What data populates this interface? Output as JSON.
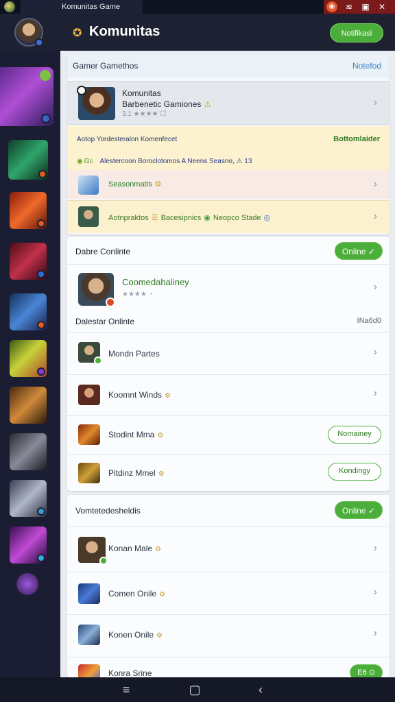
{
  "window": {
    "tab_title": "Komunitas Game",
    "sys_icons": [
      "notification-icon",
      "wifi-icon",
      "maximize-icon",
      "close-icon"
    ],
    "sys_glyphs": [
      "◉",
      "≋",
      "▣",
      "✕"
    ]
  },
  "header": {
    "brand": "Komunitas",
    "logo_glyph": "✪",
    "cta_label": "Notifikasi"
  },
  "sidebar": {
    "games": [
      "game-1",
      "game-2",
      "game-3",
      "game-4",
      "game-5",
      "game-6",
      "game-7",
      "game-8",
      "game-9",
      "game-10",
      "game-11"
    ]
  },
  "card_a": {
    "title": "Gamer Gamethos",
    "action": "Notefod",
    "featured": {
      "line1": "Komunitas",
      "line2": "Barbenetic Gamiones",
      "warn": "⚠",
      "line3": "3.1 ★★★★ ☐"
    },
    "notice": {
      "title": "Aotop Yordesteralon Komenfecet",
      "badge": "Bottomlaider",
      "sub_c1": "◉",
      "sub_c2": "Gc",
      "sub_text": "Alestercoon Boroclotomos A Neens Seasno, ⚠ 13"
    },
    "row3": {
      "label": "Seasonmatis",
      "em": "⚙"
    },
    "row4": {
      "a": "Aotnpraktos",
      "sep": "☰",
      "b": "Bacesipnics",
      "g": "◉",
      "c": "Neopco Stade",
      "d": "◎"
    }
  },
  "card_b": {
    "title": "Dabre Conlinte",
    "status_pill": "Online ✓",
    "featured": {
      "line1": "Coomedahaliney",
      "line2": "★★★★ ◔"
    },
    "section_label": "Dalestar Onlinte",
    "section_right": "INa6d0",
    "rows": [
      {
        "label": "Mondn Partes",
        "em": "",
        "button": ""
      },
      {
        "label": "Koomnt Winds",
        "em": "⚙",
        "button": ""
      },
      {
        "label": "Stodint Mma",
        "em": "⚙",
        "button": "Nomainey"
      },
      {
        "label": "Pitdinz Mmel",
        "em": "⚙",
        "button": "Kondingy"
      }
    ]
  },
  "card_c": {
    "title": "Vomtetedesheldis",
    "status_pill": "Online ✓",
    "rows": [
      {
        "label": "Konan Male",
        "em": "⚙"
      },
      {
        "label": "Comen Onile",
        "em": "⚙"
      },
      {
        "label": "Konen Onile",
        "em": "⚙"
      },
      {
        "label": "Konra Srine",
        "em": ""
      }
    ],
    "last_pill": "E6 ⊙"
  },
  "nav": {
    "menu": "≡",
    "home": "▢",
    "back": "‹"
  },
  "colors": {
    "accent_green": "#4cae3a",
    "sidebar_bg": "#1b1d33",
    "header_bg": "#1d2132"
  }
}
